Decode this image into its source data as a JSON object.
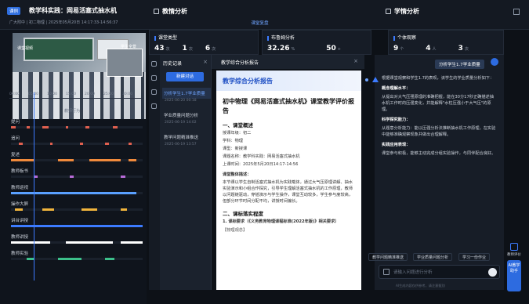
{
  "header": {
    "badge": "课例",
    "title": "教学科实践：网易活塞式抽水机",
    "meta": "广大附中 | 初二物理 | 2025年05月20日 14:17:33-14:56:37",
    "sections": [
      "教情分析",
      "学情分析"
    ]
  },
  "video": {
    "main_label": "课堂视频",
    "inset_label": "学生全景"
  },
  "timeline": {
    "ticks": [
      "00:00",
      "05:00",
      "10:00",
      "15:00",
      "20:00",
      "25:00",
      "30:00",
      "35:00"
    ],
    "subtitle": "教师行为",
    "rows": [
      {
        "label": "提问",
        "color": "#e0604f"
      },
      {
        "label": "追问",
        "color": "#e0604f"
      },
      {
        "label": "复述",
        "color": "#f08a3c"
      },
      {
        "label": "教师板书",
        "color": "#b86bd8"
      },
      {
        "label": "教师巡视",
        "color": "#5aa0ff"
      },
      {
        "label": "操作大屏",
        "color": "#f0b43c"
      },
      {
        "label": "讲台讲授",
        "color": "#3c7bff"
      },
      {
        "label": "教师讲授",
        "color": "#ffffff"
      },
      {
        "label": "教师实验",
        "color": "#3cbf8a"
      }
    ]
  },
  "panels": {
    "tab": "课堂复盘",
    "teaching_model": {
      "title": "课堂类型",
      "values": [
        "43",
        "1",
        "6"
      ],
      "units": [
        "次",
        "次",
        "次"
      ]
    },
    "behavior": {
      "title": "布鲁姆分析",
      "values": [
        "32.26",
        "50"
      ],
      "units": [
        "%",
        "+"
      ]
    },
    "students": {
      "title": "个体观察",
      "values": [
        "9",
        "4",
        "3"
      ],
      "units": [
        "个",
        "人",
        "次"
      ]
    }
  },
  "history": {
    "header": "历史记录",
    "new_chat": "新建对话",
    "items": [
      {
        "label": "分析学生1.7学业质量",
        "date": "2025-06-20 00:18",
        "active": true
      },
      {
        "label": "学业质量问题分析",
        "date": "2025-06-19 14:02",
        "active": false
      },
      {
        "label": "教学问题精准推送",
        "date": "2025-06-19 13:57",
        "active": false
      }
    ]
  },
  "report": {
    "panel_title": "教学综合分析报告",
    "banner": "教学综合分析报告",
    "title": "初中物理《网易活塞式抽水机》课堂教学评价报告",
    "s1": "一、课堂概述",
    "lines": [
      "授课年级：初二",
      "学科：物理",
      "课型：新授课",
      "课题名称：教学科实践：网易活塞式抽水机",
      "上课时间：2025年5月20日14:17-14:56"
    ],
    "overview_label": "课堂整体描述：",
    "overview": "本节课以学生自制活塞式抽水机为实践载体，通过大气压原理讲解、抽水实验演示和小组合作探究，引导学生理解活塞式抽水机的工作原理，教师以问题链驱动，穿插演示与学生操作，课堂互动较多，学生参与度较高，但部分环节时间分配不均，讲授时间偏长。",
    "s2": "二、课标落实程度",
    "s2_1": "1. 课标要求（《义务教育物理课程标准(2022年版)》相关要求）",
    "quote": "【物理观念】"
  },
  "chat": {
    "tag": "分析学生1.7学业质量",
    "intro": "根据课堂观察和学生1.7的表现，该学生的学业质量分析如下：",
    "blocks": [
      {
        "head": "概念理解水平：",
        "text": "从提出对大气压强原理的准确把握，能在30分17秒正确描述抽水机工作时的压强变化，并能解释\"水柱压强小于大气压\"的原理。"
      },
      {
        "head": "科学探究能力：",
        "text": "从题意分析能力：能以压强分析法推断抽水机工作原理，在实验中能够准确观察现象并做出合理解释。"
      },
      {
        "head": "实践应用表现：",
        "text": "课堂参与积极，能够主动完成分组实验操作，与同伴配合良好。"
      }
    ],
    "quick_actions": [
      "教学问题精准推送",
      "学业质量问题分析",
      "学习一份作业"
    ],
    "input_placeholder": "请输入问题进行分析",
    "disclaimer": "AI生成内容仅供参考，请注意甄别",
    "right_buttons": [
      "教师评价",
      "AI教学助手"
    ]
  },
  "colors": {
    "accent": "#2d6be0",
    "bg": "#0d1117"
  }
}
